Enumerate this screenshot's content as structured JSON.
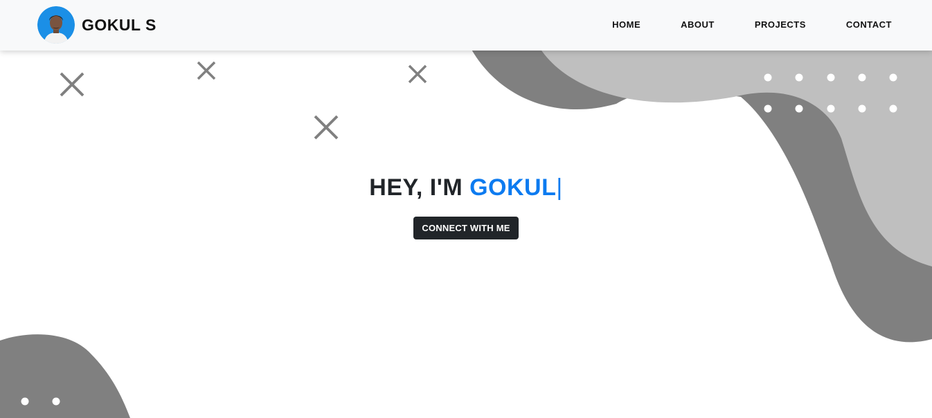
{
  "brand": {
    "name": "GOKUL S",
    "avatar_icon": "profile-photo-icon"
  },
  "nav": {
    "items": [
      {
        "label": "HOME"
      },
      {
        "label": "ABOUT"
      },
      {
        "label": "PROJECTS"
      },
      {
        "label": "CONTACT"
      }
    ]
  },
  "hero": {
    "greeting": "HEY, I'M ",
    "name": "GOKUL",
    "cursor": "|",
    "cta_label": "CONNECT WITH ME"
  },
  "colors": {
    "accent": "#0d7bf0",
    "dark": "#212529",
    "navbar_bg": "#f8f9fa",
    "shape_dark": "#808080",
    "shape_light": "#bfbfbf",
    "avatar_bg": "#1b8fe6"
  }
}
